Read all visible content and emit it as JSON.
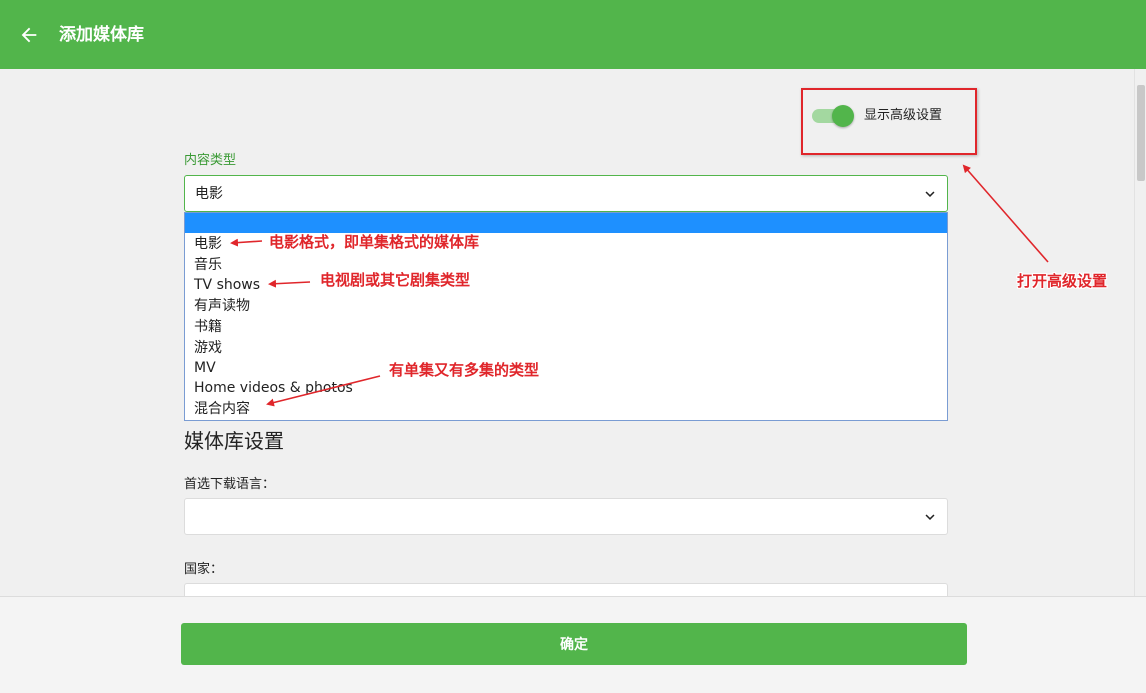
{
  "header": {
    "title": "添加媒体库",
    "back_icon": "arrow-left-icon"
  },
  "advanced": {
    "label": "显示高级设置",
    "enabled": true
  },
  "content_type": {
    "label": "内容类型",
    "selected": "电影",
    "options": [
      "",
      "电影",
      "音乐",
      "TV shows",
      "有声读物",
      "书籍",
      "游戏",
      "MV",
      "Home videos & photos",
      "混合内容"
    ]
  },
  "annotations": {
    "movies": "电影格式，即单集格式的媒体库",
    "tv": "电视剧或其它剧集类型",
    "mixed": "有单集又有多集的类型",
    "advanced": "打开高级设置"
  },
  "library_settings": {
    "title": "媒体库设置",
    "language_label": "首选下载语言：",
    "language_value": "",
    "country_label": "国家：",
    "country_value": ""
  },
  "footer": {
    "ok_label": "确定"
  },
  "colors": {
    "accent": "#52b54b",
    "annotation": "#e0262b",
    "highlight": "#1e90ff"
  }
}
